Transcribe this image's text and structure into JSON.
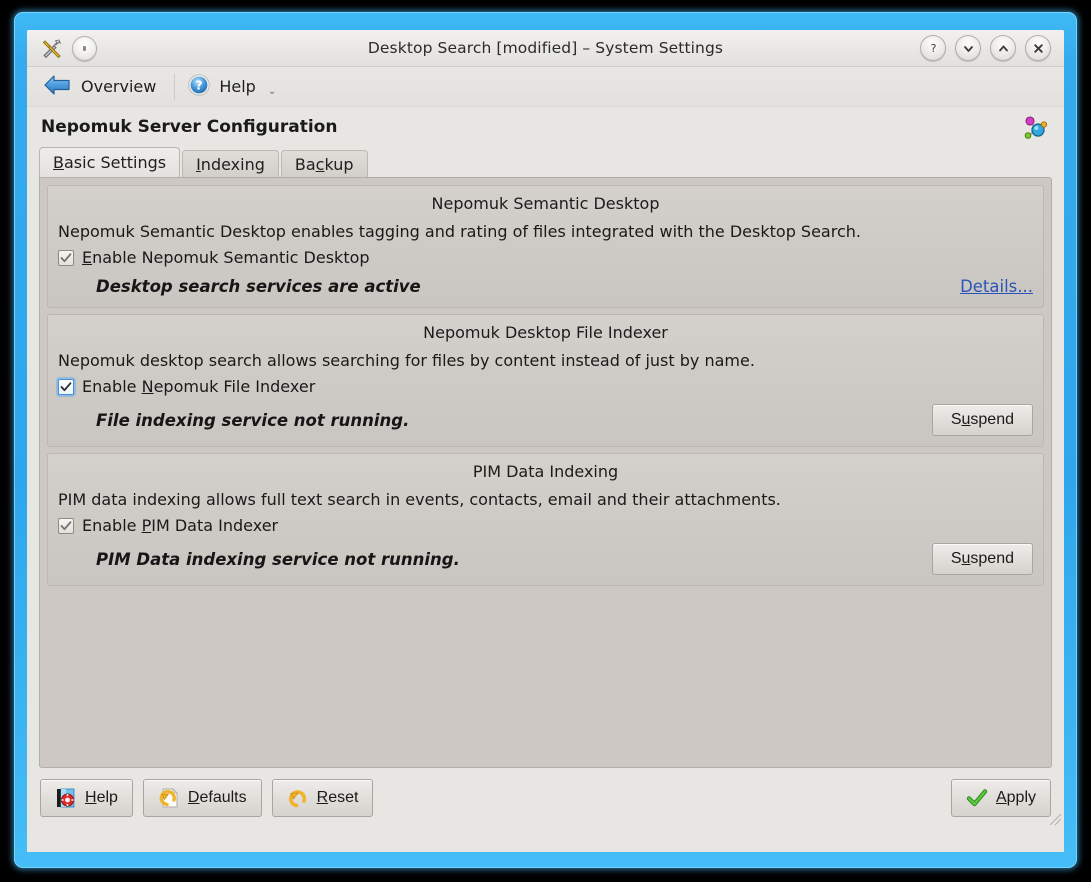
{
  "window": {
    "title": "Desktop Search [modified] – System Settings",
    "controls": [
      {
        "name": "help",
        "glyph": "?"
      },
      {
        "name": "minimize",
        "glyph": "chevron-down"
      },
      {
        "name": "maximize",
        "glyph": "chevron-up"
      },
      {
        "name": "close",
        "glyph": "x"
      }
    ]
  },
  "toolbar": {
    "overview_label": "Overview",
    "help_label": "Help",
    "overflow_caret": "⌄"
  },
  "module": {
    "title": "Nepomuk Server Configuration"
  },
  "tabs": [
    {
      "label_pre": "",
      "accel": "B",
      "label_post": "asic Settings",
      "active": true
    },
    {
      "label_pre": "",
      "accel": "I",
      "label_post": "ndexing",
      "active": false
    },
    {
      "label_pre": "Ba",
      "accel": "c",
      "label_post": "kup",
      "active": false
    }
  ],
  "groups": [
    {
      "title": "Nepomuk Semantic Desktop",
      "description": "Nepomuk Semantic Desktop enables tagging and rating of files integrated with the Desktop Search.",
      "checkbox": {
        "label_pre": "",
        "accel": "E",
        "label_post": "nable Nepomuk Semantic Desktop",
        "checked": true,
        "focused": false
      },
      "status": "Desktop search services are active",
      "action": {
        "type": "link",
        "label": "Details..."
      }
    },
    {
      "title": "Nepomuk Desktop File Indexer",
      "description": "Nepomuk desktop search allows searching for files by content instead of just by name.",
      "checkbox": {
        "label_pre": "Enable ",
        "accel": "N",
        "label_post": "epomuk File Indexer",
        "checked": true,
        "focused": true
      },
      "status": "File indexing service not running.",
      "action": {
        "type": "button",
        "label_pre": "S",
        "accel": "u",
        "label_post": "spend"
      }
    },
    {
      "title": "PIM Data Indexing",
      "description": "PIM data indexing allows full text search in events, contacts, email and their attachments.",
      "checkbox": {
        "label_pre": "Enable ",
        "accel": "P",
        "label_post": "IM Data Indexer",
        "checked": true,
        "focused": false
      },
      "status": "PIM Data indexing service not running.",
      "action": {
        "type": "button",
        "label_pre": "S",
        "accel": "u",
        "label_post": "spend"
      }
    }
  ],
  "footer": {
    "help": {
      "label_pre": "",
      "accel": "H",
      "label_post": "elp"
    },
    "defaults": {
      "label_pre": "",
      "accel": "D",
      "label_post": "efaults"
    },
    "reset": {
      "label_pre": "",
      "accel": "R",
      "label_post": "eset"
    },
    "apply": {
      "label_pre": "",
      "accel": "A",
      "label_post": "pply"
    }
  },
  "colors": {
    "frame_blue": "#35aaee",
    "link_blue": "#2a55b8",
    "focus_blue": "#4a90d9",
    "apply_green": "#39a025",
    "window_bg": "#e8e6e3",
    "pane_bg": "#cdc8c3"
  }
}
